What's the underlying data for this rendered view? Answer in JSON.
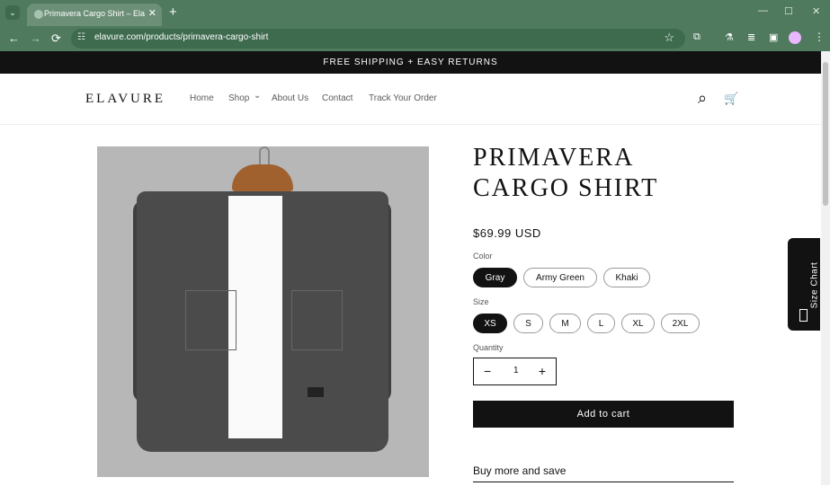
{
  "browser": {
    "tab_title": "Primavera Cargo Shirt – Elavure",
    "url": "elavure.com/products/primavera-cargo-shirt",
    "new_tab": "+",
    "close": "✕"
  },
  "announcement": "FREE SHIPPING + EASY RETURNS",
  "header": {
    "logo": "ELAVURE",
    "nav": [
      "Home",
      "Shop",
      "About Us",
      "Contact",
      "Track Your Order"
    ]
  },
  "product": {
    "title": "PRIMAVERA CARGO SHIRT",
    "price": "$69.99 USD",
    "color_label": "Color",
    "colors": [
      "Gray",
      "Army Green",
      "Khaki"
    ],
    "selected_color": "Gray",
    "size_label": "Size",
    "sizes": [
      "XS",
      "S",
      "M",
      "L",
      "XL",
      "2XL"
    ],
    "selected_size": "XS",
    "quantity_label": "Quantity",
    "quantity": "1",
    "add_to_cart": "Add to cart",
    "buy_more": "Buy more and save"
  },
  "size_chart": "Size Chart",
  "icons": {
    "back": "←",
    "forward": "→",
    "reload": "⟳",
    "star": "☆",
    "search": "⌕",
    "cart": "🛒",
    "chevron": "⌄",
    "minus": "−",
    "plus": "+"
  }
}
